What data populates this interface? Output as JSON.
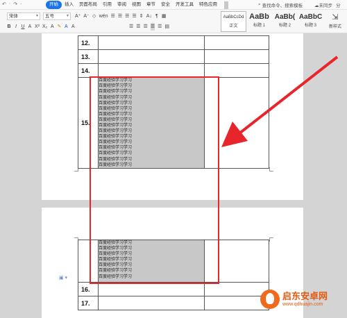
{
  "menubar": {
    "quick_access": [
      "↶",
      "·",
      "↷",
      "·"
    ],
    "tabs": [
      "开始",
      "插入",
      "页面布局",
      "引用",
      "审阅",
      "视图",
      "章节",
      "安全",
      "开发工具",
      "特色应用"
    ],
    "active_tab": "开始",
    "search_text": "查找命令、搜索模板",
    "sync_text": "未同步",
    "share_label": "分"
  },
  "toolbar": {
    "font_name": "宋体",
    "font_size": "五号",
    "row1_buttons": [
      "A⁺",
      "A⁻",
      "◇",
      "wén",
      "☰",
      "☰",
      "☰",
      "☰",
      "⇕",
      "A↓",
      "¶",
      "▦"
    ],
    "row2_buttons": [
      "B",
      "I",
      "U",
      "A",
      "X²",
      "X₂",
      "A",
      "✎",
      "A",
      "A"
    ],
    "align_buttons": [
      "☰",
      "☰",
      "☰",
      "☰",
      "☰",
      "▤"
    ],
    "styles": [
      {
        "sample": "AaBbCcDd",
        "name": "正文"
      },
      {
        "sample": "AaBb",
        "name": "标题 1"
      },
      {
        "sample": "AaBb(",
        "name": "标题 2"
      },
      {
        "sample": "AaBbC",
        "name": "标题 3"
      }
    ],
    "new_style_label": "新样式"
  },
  "table_page1": {
    "rows_before": [
      "12.",
      "13.",
      "14."
    ],
    "big_row_label": "15.",
    "big_row_lines": [
      "百度经验学习学习",
      "百度经验学习学习",
      "百度经验学习学习",
      "百度经验学习学习",
      "百度经验学习学习",
      "百度经验学习学习",
      "百度经验学习学习",
      "百度经验学习学习",
      "百度经验学习学习",
      "百度经验学习学习",
      "百度经验学习学习",
      "百度经验学习学习",
      "百度经验学习学习",
      "百度经验学习学习",
      "百度经验学习学习",
      "百度经验学习学习"
    ]
  },
  "table_page2": {
    "continued_lines": [
      "百度经验学习学习",
      "百度经验学习学习",
      "百度经验学习学习",
      "百度经验学习学习",
      "百度经验学习学习",
      "百度经验学习学习",
      "百度经验学习学习"
    ],
    "rows_after": [
      "16.",
      "17."
    ]
  },
  "watermark": {
    "title": "启东安卓网",
    "url": "www.qdhuajin.com"
  },
  "colors": {
    "accent": "#1a73e8",
    "highlight_box": "#e8252a",
    "cell_shading": "#c8c8c8",
    "watermark": "#e25b12"
  }
}
